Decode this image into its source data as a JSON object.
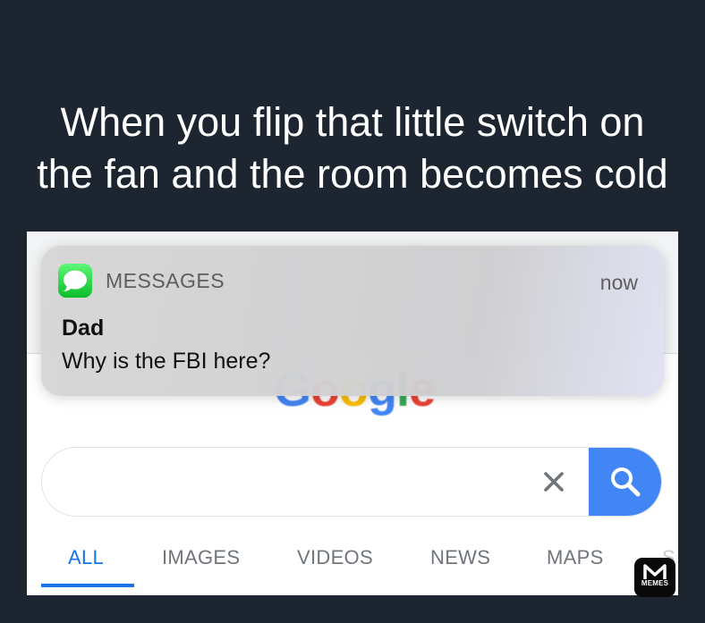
{
  "caption": {
    "line1": "When you flip that little switch on",
    "line2": "the fan and the room becomes cold"
  },
  "notification": {
    "app_name": "MESSAGES",
    "time": "now",
    "sender": "Dad",
    "message": "Why is the FBI here?",
    "app_icon": "messages-bubble-icon"
  },
  "google": {
    "logo_letters": [
      "G",
      "o",
      "o",
      "g",
      "l",
      "e"
    ],
    "search": {
      "value": "",
      "placeholder": ""
    },
    "clear_icon": "close-icon",
    "search_icon": "magnifier-icon",
    "tabs": [
      {
        "label": "ALL",
        "active": true
      },
      {
        "label": "IMAGES",
        "active": false
      },
      {
        "label": "VIDEOS",
        "active": false
      },
      {
        "label": "NEWS",
        "active": false
      },
      {
        "label": "MAPS",
        "active": false
      }
    ]
  },
  "watermark": {
    "label": "MEMES"
  },
  "colors": {
    "background": "#1c2530",
    "google_blue": "#4285f4",
    "active_tab": "#1a73e8",
    "messages_green": "#1fd13b"
  }
}
